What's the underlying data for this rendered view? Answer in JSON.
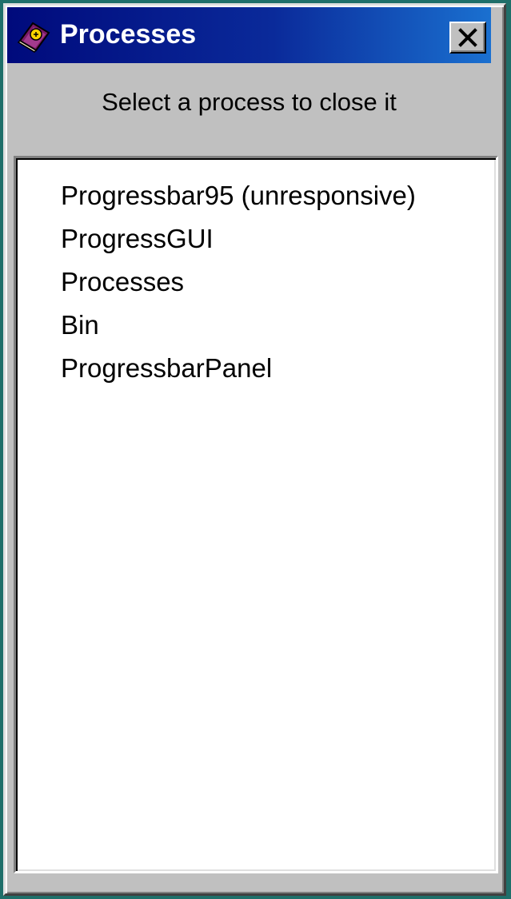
{
  "window": {
    "title": "Processes",
    "icon": "app-icon",
    "close_icon": "close-icon"
  },
  "instruction": "Select a process to close it",
  "processes": [
    "Progressbar95 (unresponsive)",
    "ProgressGUI",
    "Processes",
    "Bin",
    "ProgressbarPanel"
  ],
  "colors": {
    "title_bar_start": "#000a7c",
    "title_bar_end": "#1a70d0",
    "window_face": "#c0c0c0",
    "desktop": "#1f6f6a"
  }
}
